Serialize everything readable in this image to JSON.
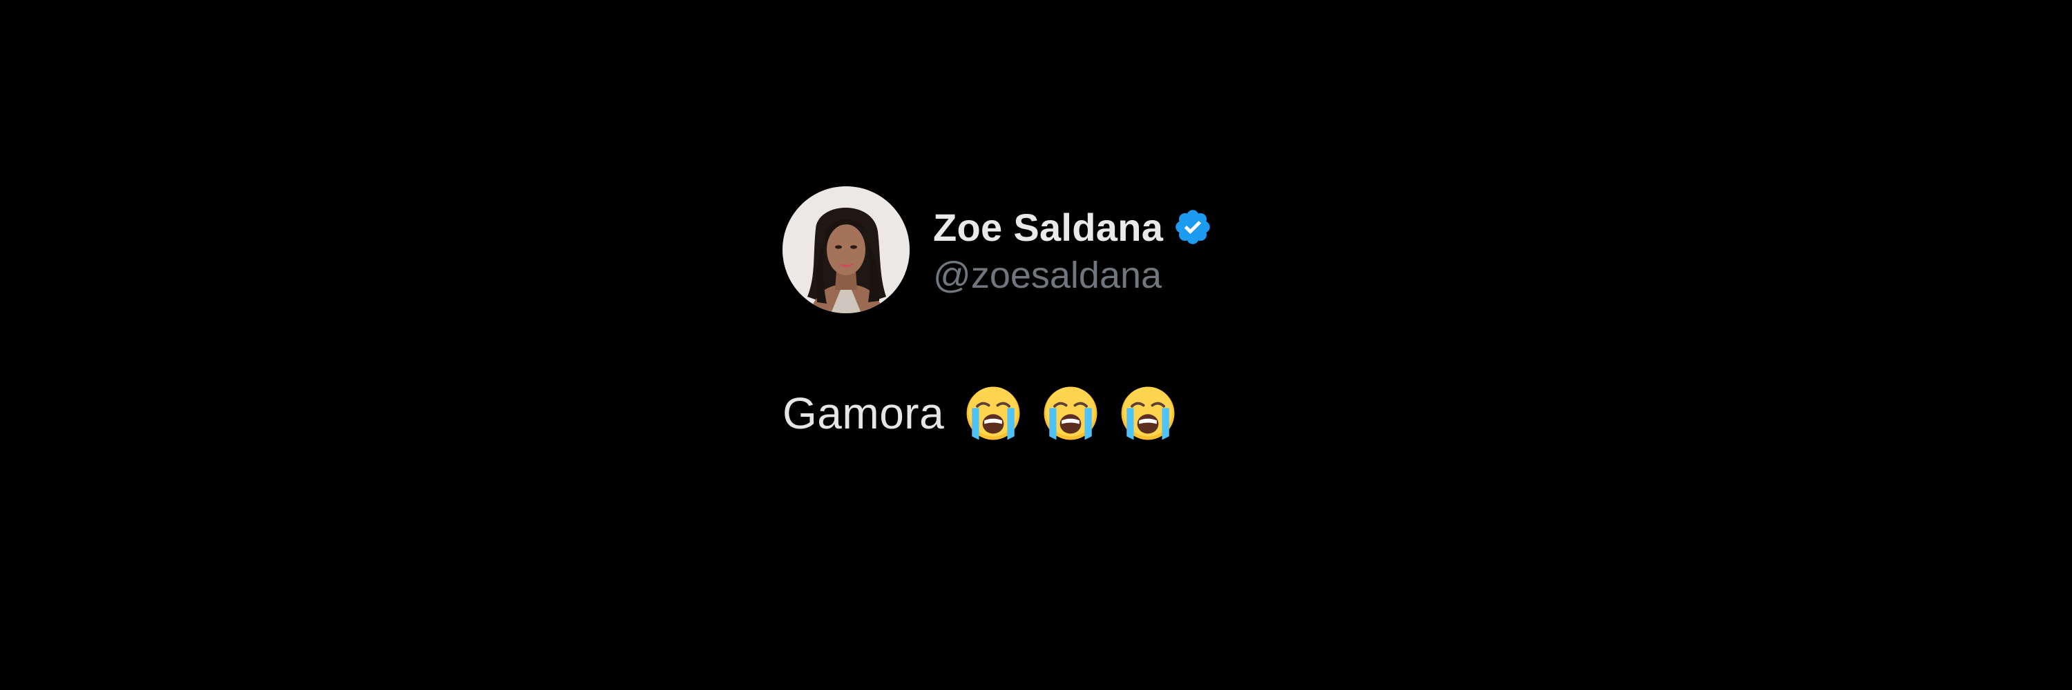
{
  "tweet": {
    "author_name": "Zoe Saldana",
    "author_handle": "@zoesaldana",
    "verified": true,
    "text": "Gamora",
    "emojis": [
      "loudly-crying-face-icon",
      "loudly-crying-face-icon",
      "loudly-crying-face-icon"
    ]
  },
  "colors": {
    "background": "#000000",
    "name": "#e9e9e9",
    "handle": "#6f767d",
    "verified_badge": "#1d9bf0",
    "text": "#e6e6e6"
  }
}
